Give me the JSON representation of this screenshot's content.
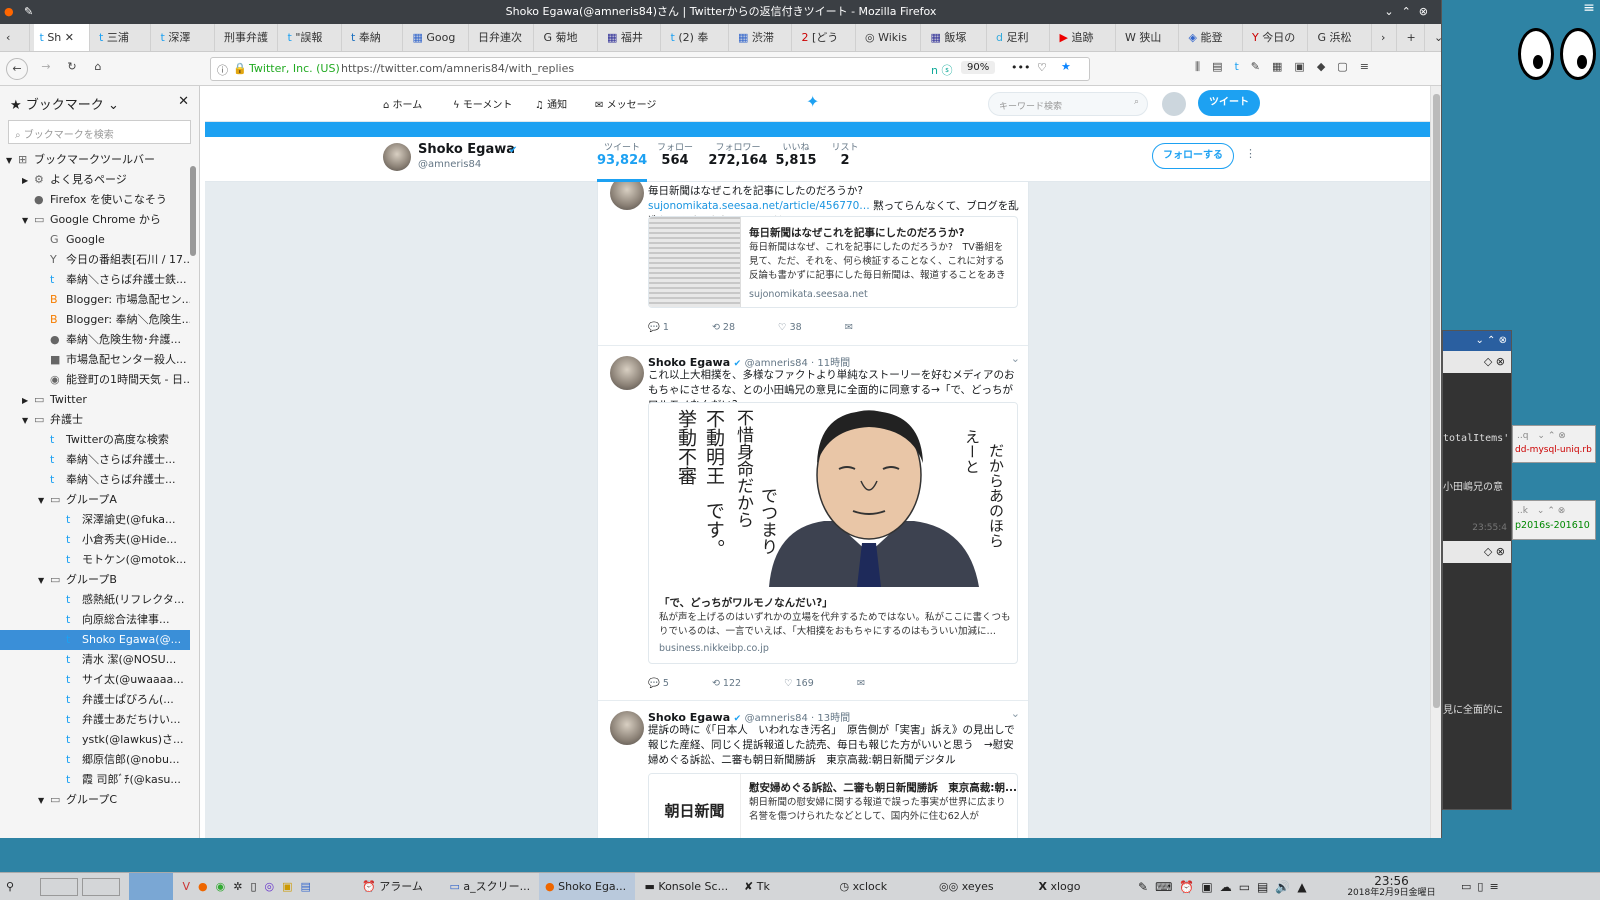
{
  "window": {
    "title": "Shoko Egawa(@amneris84)さん | Twitterからの返信付きツイート - Mozilla Firefox"
  },
  "tabs": [
    "Sh",
    "三浦",
    "深澤",
    "刑事弁護",
    "\"誤報",
    "奉納",
    "Goog",
    "日弁連次",
    "菊地",
    "福井",
    "(2) 奉",
    "渋滞",
    "[どう",
    "Wikis",
    "飯塚",
    "足利",
    "追跡",
    "狭山",
    "能登",
    "今日の",
    "浜松"
  ],
  "navbar": {
    "identity": "Twitter, Inc. (US)",
    "url": "https://twitter.com/amneris84/with_replies",
    "zoom": "90%"
  },
  "sidebar": {
    "title": "ブックマーク",
    "search_placeholder": "ブックマークを検索",
    "items": [
      {
        "label": "ブックマークツールバー",
        "indent": 0,
        "arrow": "▼",
        "icon": "⊞"
      },
      {
        "label": "よく見るページ",
        "indent": 1,
        "arrow": "▶",
        "icon": "⚙"
      },
      {
        "label": "Firefox を使いこなそう",
        "indent": 1,
        "arrow": "",
        "icon": "●"
      },
      {
        "label": "Google Chrome から",
        "indent": 1,
        "arrow": "▼",
        "icon": "▭"
      },
      {
        "label": "Google",
        "indent": 2,
        "arrow": "",
        "icon": "G"
      },
      {
        "label": "今日の番組表[石川 / 17...",
        "indent": 2,
        "arrow": "",
        "icon": "Y"
      },
      {
        "label": "奉納＼さらば弁護士鉄...",
        "indent": 2,
        "arrow": "",
        "icon": "t"
      },
      {
        "label": "Blogger: 市場急配セン...",
        "indent": 2,
        "arrow": "",
        "icon": "B"
      },
      {
        "label": "Blogger: 奉納＼危険生...",
        "indent": 2,
        "arrow": "",
        "icon": "B"
      },
      {
        "label": "奉納＼危険生物･弁護...",
        "indent": 2,
        "arrow": "",
        "icon": "●"
      },
      {
        "label": "市場急配センター殺人...",
        "indent": 2,
        "arrow": "",
        "icon": "■"
      },
      {
        "label": "能登町の1時間天気 - 日...",
        "indent": 2,
        "arrow": "",
        "icon": "◉"
      },
      {
        "label": "Twitter",
        "indent": 1,
        "arrow": "▶",
        "icon": "▭"
      },
      {
        "label": "弁護士",
        "indent": 1,
        "arrow": "▼",
        "icon": "▭"
      },
      {
        "label": "Twitterの高度な検索",
        "indent": 2,
        "arrow": "",
        "icon": "t"
      },
      {
        "label": "奉納＼さらば弁護士...",
        "indent": 2,
        "arrow": "",
        "icon": "t"
      },
      {
        "label": "奉納＼さらば弁護士...",
        "indent": 2,
        "arrow": "",
        "icon": "t"
      },
      {
        "label": "グループA",
        "indent": 2,
        "arrow": "▼",
        "icon": "▭"
      },
      {
        "label": "深澤諭史(@fuka...",
        "indent": 3,
        "arrow": "",
        "icon": "t"
      },
      {
        "label": "小倉秀夫(@Hide...",
        "indent": 3,
        "arrow": "",
        "icon": "t"
      },
      {
        "label": "モトケン(@motok...",
        "indent": 3,
        "arrow": "",
        "icon": "t"
      },
      {
        "label": "グループB",
        "indent": 2,
        "arrow": "▼",
        "icon": "▭"
      },
      {
        "label": "感熱紙(リフレクタ...",
        "indent": 3,
        "arrow": "",
        "icon": "t"
      },
      {
        "label": "向原総合法律事...",
        "indent": 3,
        "arrow": "",
        "icon": "t"
      },
      {
        "label": "Shoko Egawa(@...",
        "indent": 3,
        "arrow": "",
        "icon": "t",
        "selected": true
      },
      {
        "label": "清水 潔(@NOSU...",
        "indent": 3,
        "arrow": "",
        "icon": "t"
      },
      {
        "label": "サイ太(@uwaaaa...",
        "indent": 3,
        "arrow": "",
        "icon": "t"
      },
      {
        "label": "弁護士ぱびろん(...",
        "indent": 3,
        "arrow": "",
        "icon": "t"
      },
      {
        "label": "弁護士あだちけい...",
        "indent": 3,
        "arrow": "",
        "icon": "t"
      },
      {
        "label": "ystk(@lawkus)さ...",
        "indent": 3,
        "arrow": "",
        "icon": "t"
      },
      {
        "label": "郷原信郎(@nobu...",
        "indent": 3,
        "arrow": "",
        "icon": "t"
      },
      {
        "label": "霞 司郎ﾞﾁ(@kasu...",
        "indent": 3,
        "arrow": "",
        "icon": "t"
      },
      {
        "label": "グループC",
        "indent": 2,
        "arrow": "▼",
        "icon": "▭"
      }
    ]
  },
  "twitter": {
    "nav": {
      "home": "ホーム",
      "moments": "モーメント",
      "notifications": "通知",
      "messages": "メッセージ",
      "search_placeholder": "キーワード検索",
      "tweet_button": "ツイート"
    },
    "profile": {
      "name": "Shoko Egawa",
      "handle": "@amneris84",
      "follow_button": "フォローする",
      "stats": [
        {
          "label": "ツイート",
          "value": "93,824"
        },
        {
          "label": "フォロー",
          "value": "564"
        },
        {
          "label": "フォロワー",
          "value": "272,164"
        },
        {
          "label": "いいね",
          "value": "5,815"
        },
        {
          "label": "リスト",
          "value": "2"
        }
      ]
    },
    "tweets": [
      {
        "text_pre": "毎日新聞はなぜこれを記事にしたのだろうか?",
        "link": "sujonomikata.seesaa.net/article/456770…",
        "text_post": "黙ってらんなくて、ブログを乱造してます。もうヨレヨレだ。",
        "card_title": "毎日新聞はなぜこれを記事にしたのだろうか?",
        "card_desc": "毎日新聞はなぜ、これを記事にしたのだろうか?　TV番組を見て、ただ、それを、何ら検証することなく、これに対する反論も書かずに記事にした毎日新聞は、報道することをあきらめ…",
        "card_domain": "sujonomikata.seesaa.net",
        "replies": "1",
        "retweets": "28",
        "likes": "38"
      },
      {
        "name": "Shoko Egawa",
        "handle": "@amneris84",
        "time": "11時間",
        "text": "これ以上大相撲を、多様なファクトより単純なストーリーを好むメディアのおもちゃにさせるな、との小田嶋兄の意見に全面的に同意する→「で、どっちがワルモノなんだい?」",
        "image_text": [
          "挙動不審",
          "不動明王",
          "です。",
          "不惜身命だから",
          "でつまり",
          "えーと",
          "だからあのほら"
        ],
        "card_title": "「で、どっちがワルモノなんだい?」",
        "card_desc": "私が声を上げるのはいずれかの立場を代弁するためではない。私がここに書くつもりでいるのは、一言でいえば、「大相撲をおもちゃにするのはもういい加減に…",
        "card_domain": "business.nikkeibp.co.jp",
        "replies": "5",
        "retweets": "122",
        "likes": "169"
      },
      {
        "name": "Shoko Egawa",
        "handle": "@amneris84",
        "time": "13時間",
        "text": "提訴の時に《「日本人　いわれなき汚名」　原告側が「実害」訴え》の見出しで報じた産経、同じく提訴報道した読売、毎日も報じた方がいいと思う　→慰安婦めぐる訴訟、二審も朝日新聞勝訴　東京高裁:朝日新聞デジタル",
        "card_title": "慰安婦めぐる訴訟、二審も朝日新聞勝訴　東京高裁:朝...",
        "card_desc": "朝日新聞の慰安婦に関する報道で誤った事実が世界に広まり名誉を傷つけられたなどとして、国内外に住む62人が",
        "card_logo": "朝日新聞"
      }
    ]
  },
  "right": {
    "a": "totalItems'",
    "b": "dd-mysql-uniq.rb",
    "c": "小田嶋兄の意",
    "d": "p2016s-201610",
    "e": "23:55:4",
    "f": "見に全面的に"
  },
  "taskbar": {
    "items": [
      "アラーム",
      "a_スクリー...",
      "Shoko Ega...",
      "Konsole Sc...",
      "Tk",
      "xclock",
      "xeyes",
      "xlogo"
    ],
    "time": "23:56",
    "date": "2018年2月9日金曜日"
  }
}
